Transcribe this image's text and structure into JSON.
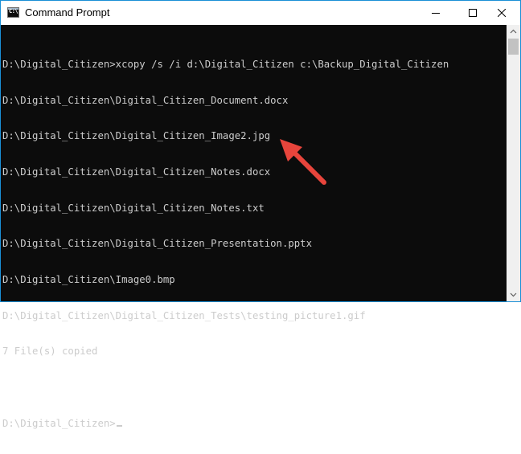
{
  "window": {
    "title": "Command Prompt",
    "icon": "cmd-icon"
  },
  "controls": {
    "minimize": "minimize-icon",
    "maximize": "maximize-icon",
    "close": "close-icon"
  },
  "console": {
    "lines": [
      "D:\\Digital_Citizen>xcopy /s /i d:\\Digital_Citizen c:\\Backup_Digital_Citizen",
      "D:\\Digital_Citizen\\Digital_Citizen_Document.docx",
      "D:\\Digital_Citizen\\Digital_Citizen_Image2.jpg",
      "D:\\Digital_Citizen\\Digital_Citizen_Notes.docx",
      "D:\\Digital_Citizen\\Digital_Citizen_Notes.txt",
      "D:\\Digital_Citizen\\Digital_Citizen_Presentation.pptx",
      "D:\\Digital_Citizen\\Image0.bmp",
      "D:\\Digital_Citizen\\Digital_Citizen_Tests\\testing_picture1.gif",
      "7 File(s) copied",
      "",
      "D:\\Digital_Citizen>"
    ]
  },
  "colors": {
    "console_background": "#0c0c0c",
    "console_text": "#cccccc",
    "annotation_arrow": "#e8453c",
    "window_border": "#1a8fd6"
  }
}
